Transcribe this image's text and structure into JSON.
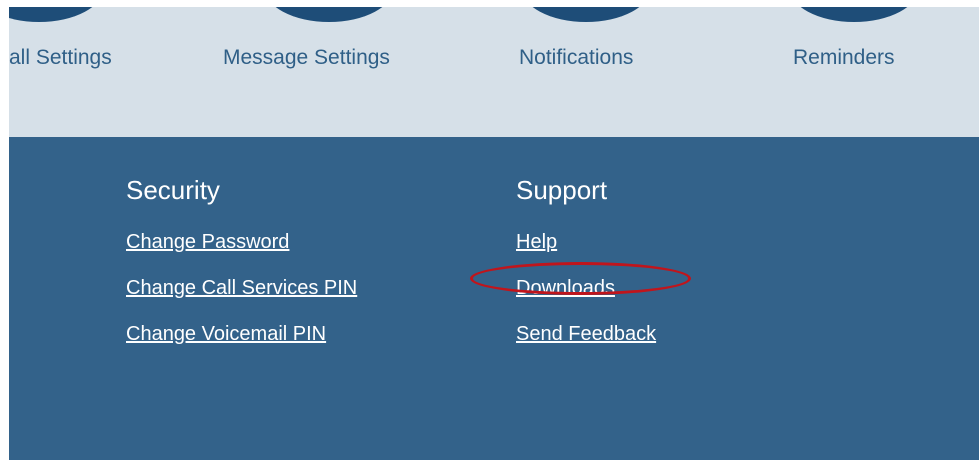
{
  "settings_row": {
    "items": [
      {
        "label": "all Settings"
      },
      {
        "label": "Message Settings"
      },
      {
        "label": "Notifications"
      },
      {
        "label": "Reminders"
      }
    ]
  },
  "footer": {
    "security": {
      "heading": "Security",
      "links": [
        "Change Password",
        "Change Call Services PIN",
        "Change Voicemail PIN"
      ]
    },
    "support": {
      "heading": "Support",
      "links": [
        "Help",
        "Downloads",
        "Send Feedback"
      ]
    }
  },
  "annotation": {
    "highlighted_link": "Downloads",
    "color": "#c0151c"
  },
  "colors": {
    "footer_bg": "#33628a",
    "top_bg": "#d6e0e8",
    "circle": "#1e4d78"
  }
}
